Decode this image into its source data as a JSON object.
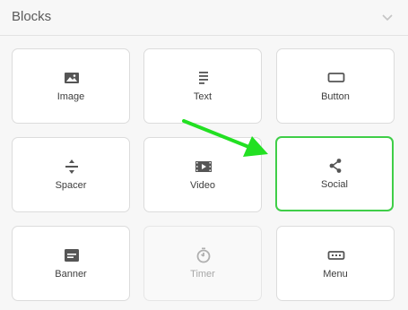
{
  "panel": {
    "title": "Blocks",
    "toggle_icon": "chevron-down-icon"
  },
  "blocks": [
    {
      "label": "Image",
      "icon": "image-icon"
    },
    {
      "label": "Text",
      "icon": "text-lines-icon"
    },
    {
      "label": "Button",
      "icon": "button-rectangle-icon"
    },
    {
      "label": "Spacer",
      "icon": "spacer-icon"
    },
    {
      "label": "Video",
      "icon": "video-icon"
    },
    {
      "label": "Social",
      "icon": "share-icon",
      "highlighted": true
    },
    {
      "label": "Banner",
      "icon": "banner-icon"
    },
    {
      "label": "Timer",
      "icon": "timer-icon",
      "disabled": true
    },
    {
      "label": "Menu",
      "icon": "menu-icon"
    }
  ],
  "colors": {
    "highlight": "#3fce48",
    "arrow": "#22e022",
    "icon": "#555555",
    "icon_disabled": "#b0b0b0"
  },
  "annotation": {
    "type": "arrow",
    "points_to": "Social",
    "icon": "arrow-icon"
  }
}
